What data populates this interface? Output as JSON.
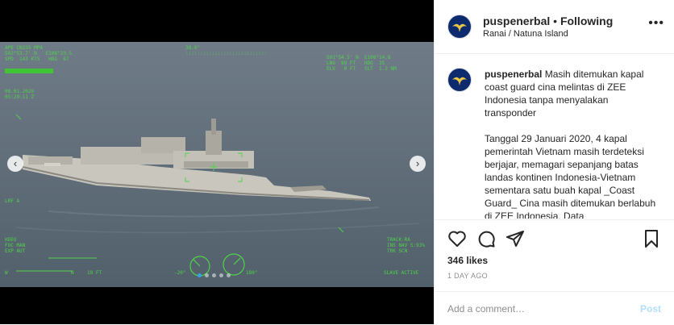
{
  "media": {
    "hud": {
      "top_left": "APE CN235 MPA\nS02°53.7' N   E108°23.5\nSPD  143 KTS   HDG  87\n",
      "top_center": "38.6°\n::::::::::::::::::::::::::::",
      "top_right": "S01°54.5' N  E108°14.8\nLNG  89 FT   HDG  35\nELV   0 FT   SLT  1.2 NM",
      "date": "08.01.2020\n05:29:11 Z",
      "lrf": "LRF A",
      "bottom_left": "HDEO\nFOC MAN\nEXP AUT",
      "bottom_right": "TRACK:RA\nINS NAV S:93%\nTRK SCN",
      "bottom_right2": "SLAVE ACTIVE",
      "w_label": "W",
      "n_label": "N",
      "ft_label": "19 FT",
      "angle_left": "-20°",
      "angle_right": "180°"
    },
    "prev_glyph": "‹",
    "next_glyph": "›",
    "slide_count": 5,
    "active_slide": 1
  },
  "header": {
    "username": "puspenerbal",
    "separator": " • ",
    "follow_status": "Following",
    "location": "Ranai / Natuna Island",
    "more_glyph": "•••"
  },
  "caption": {
    "username": "puspenerbal",
    "text": "Masih ditemukan kapal coast guard cina melintas di ZEE Indonesia tanpa menyalakan transponder",
    "body": "Tanggal 29 Januari 2020, 4 kapal pemerintah Vietnam masih terdeteksi berjajar, memagari sepanjang batas landas kontinen Indonesia-Vietnam sementara satu buah kapal _Coast Guard_ Cina masih ditemukan berlabuh di ZEE Indonesia. Data"
  },
  "actions": {
    "likes": "346 likes",
    "time": "1 DAY AGO",
    "icons": [
      "heart-icon",
      "comment-icon",
      "share-icon",
      "bookmark-icon"
    ]
  },
  "comment_box": {
    "placeholder": "Add a comment…",
    "post_label": "Post"
  }
}
